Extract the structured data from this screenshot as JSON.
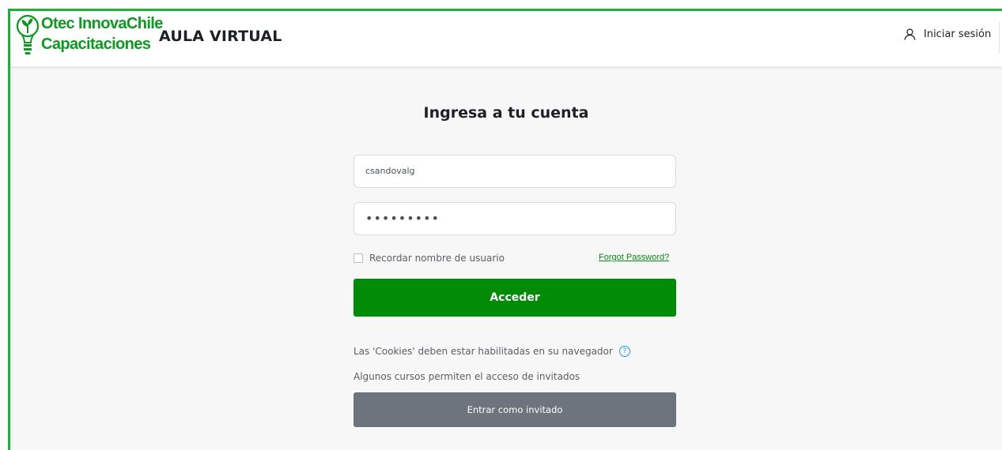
{
  "brand": {
    "logo_line1": "Otec InnovaChile",
    "logo_line2": "Capacitaciones",
    "icon": "lightbulb-plant-icon",
    "accent_color": "#1fb23a",
    "primary_button_color": "#018c08",
    "secondary_button_color": "#6c757d"
  },
  "header": {
    "site_title": "AULA VIRTUAL",
    "login_label": "Iniciar sesión",
    "login_icon": "user-icon"
  },
  "login": {
    "heading": "Ingresa a tu cuenta",
    "username_value": "csandovalg",
    "password_value": "•••••••••",
    "remember_label": "Recordar nombre de usuario",
    "forgot_label": "Forgot Password?",
    "submit_label": "Acceder",
    "cookies_text": "Las 'Cookies' deben estar habilitadas en su navegador",
    "help_icon": "question-circle-icon",
    "guest_text": "Algunos cursos permiten el acceso de invitados",
    "guest_button_label": "Entrar como invitado"
  }
}
